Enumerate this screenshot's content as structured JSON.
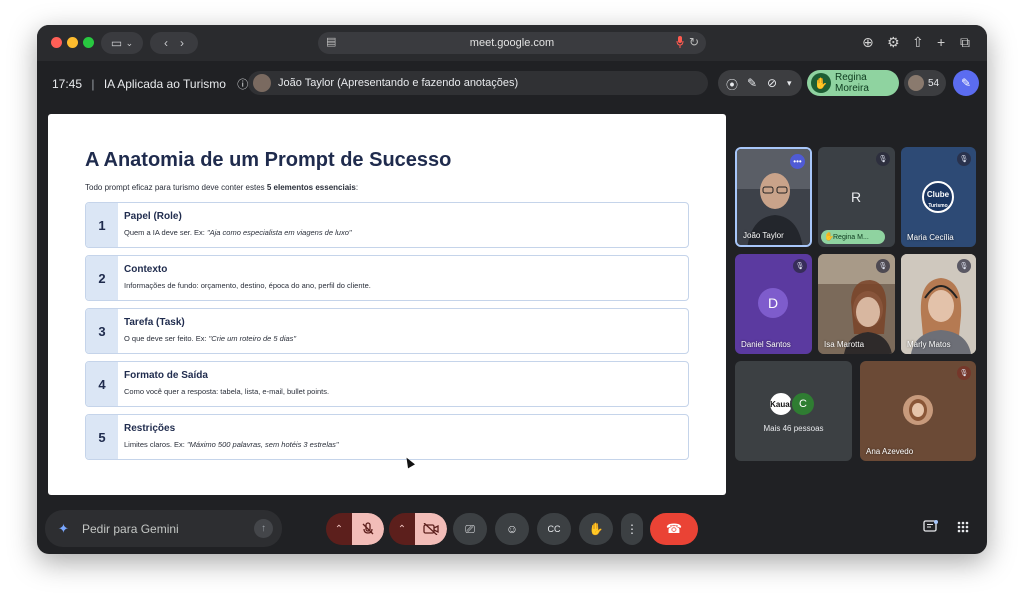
{
  "browser": {
    "url": "meet.google.com"
  },
  "meeting": {
    "time": "17:45",
    "separator": "|",
    "title": "IA Aplicada ao Turismo",
    "presenter_status": "João Taylor (Apresentando e fazendo anotações)",
    "raised_hand_name": "Regina Moreira",
    "participant_count": "54"
  },
  "slide": {
    "title": "A Anatomia de um Prompt de Sucesso",
    "subtitle_prefix": "Todo prompt eficaz para turismo deve conter estes ",
    "subtitle_bold": "5 elementos essenciais",
    "subtitle_suffix": ":",
    "items": [
      {
        "num": "1",
        "title": "Papel (Role)",
        "desc": "Quem a IA deve ser. Ex: ",
        "example": "\"Aja como especialista em viagens de luxo\""
      },
      {
        "num": "2",
        "title": "Contexto",
        "desc": "Informações de fundo: orçamento, destino, época do ano, perfil do cliente.",
        "example": ""
      },
      {
        "num": "3",
        "title": "Tarefa (Task)",
        "desc": "O que deve ser feito. Ex: ",
        "example": "\"Crie um roteiro de 5 dias\""
      },
      {
        "num": "4",
        "title": "Formato de Saída",
        "desc": "Como você quer a resposta: tabela, lista, e-mail, bullet points.",
        "example": ""
      },
      {
        "num": "5",
        "title": "Restrições",
        "desc": "Limites claros. Ex: ",
        "example": "\"Máximo 500 palavras, sem hotéis 3 estrelas\""
      }
    ]
  },
  "participants": {
    "joao": "João Taylor",
    "regina_letter": "R",
    "regina_chip": "Regina M...",
    "maria": "Maria Cecília",
    "clube_logo": "Clube",
    "clube_logo_sub": "Turismo",
    "daniel_letter": "D",
    "daniel": "Daniel Santos",
    "isa": "Isa Marotta",
    "marly": "Marly Matos",
    "others_avatar_1": "Kauai",
    "others_avatar_2": "C",
    "others": "Mais 46 pessoas",
    "ana": "Ana Azevedo"
  },
  "bottom": {
    "gemini_placeholder": "Pedir para Gemini"
  },
  "colors": {
    "slide_navy": "#1f2b4d",
    "hand_green": "#8fd3a0",
    "end_call_red": "#ea4335",
    "mic_off_bg": "#f2bdb8"
  }
}
